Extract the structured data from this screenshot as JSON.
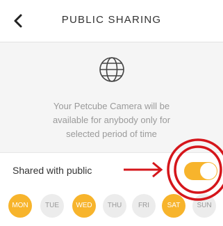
{
  "header": {
    "title": "PUBLIC SHARING",
    "back_icon": "chevron-left-icon"
  },
  "info": {
    "icon": "globe-icon",
    "line1": "Your Petcube Camera will be",
    "line2": "available for anybody only for",
    "line3": "selected period of time"
  },
  "sharing": {
    "label": "Shared with public",
    "enabled": true
  },
  "days": [
    {
      "label": "MON",
      "selected": true
    },
    {
      "label": "TUE",
      "selected": false
    },
    {
      "label": "WED",
      "selected": true
    },
    {
      "label": "THU",
      "selected": false
    },
    {
      "label": "FRI",
      "selected": false
    },
    {
      "label": "SAT",
      "selected": true
    },
    {
      "label": "SUN",
      "selected": false
    }
  ],
  "colors": {
    "accent": "#f7b42c",
    "annotation": "#d5161b"
  }
}
